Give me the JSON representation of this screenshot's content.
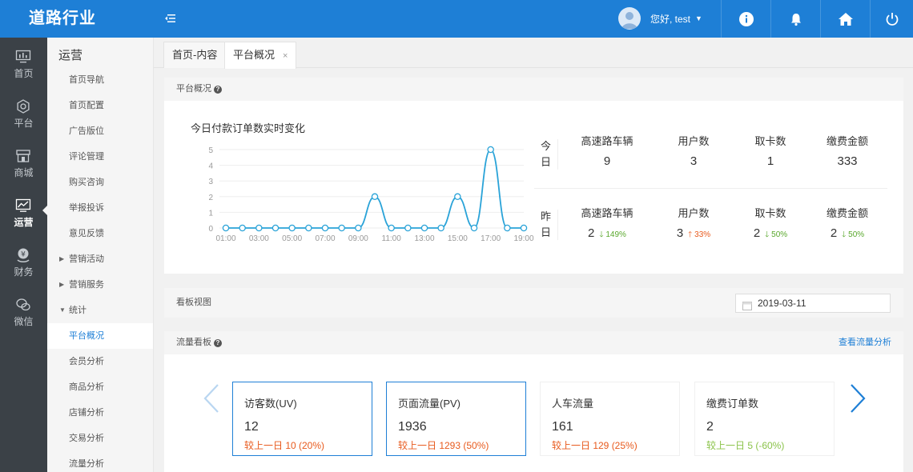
{
  "app": {
    "title": "道路行业"
  },
  "user": {
    "greeting": "您好, test"
  },
  "sidebar": {
    "items": [
      {
        "label": "首页",
        "icon": "monitor-icon"
      },
      {
        "label": "平台",
        "icon": "gear-icon"
      },
      {
        "label": "商城",
        "icon": "store-icon"
      },
      {
        "label": "运营",
        "icon": "chart-icon"
      },
      {
        "label": "财务",
        "icon": "finance-icon"
      },
      {
        "label": "微信",
        "icon": "wechat-icon"
      }
    ],
    "active": "运营"
  },
  "submenu": {
    "title": "运营",
    "items": [
      "首页导航",
      "首页配置",
      "广告版位",
      "评论管理",
      "购买咨询",
      "举报投诉",
      "意见反馈",
      "营销活动",
      "营销服务",
      "统计",
      "平台概况",
      "会员分析",
      "商品分析",
      "店铺分析",
      "交易分析",
      "流量分析"
    ]
  },
  "tabs": [
    {
      "label": "首页-内容"
    },
    {
      "label": "平台概况",
      "close": "×"
    }
  ],
  "overview": {
    "heading": "平台概况",
    "help": "?",
    "chart_title": "今日付款订单数实时变化",
    "today_label": [
      "今",
      "日"
    ],
    "yesterday_label": [
      "昨",
      "日"
    ],
    "today": [
      {
        "name": "高速路车辆",
        "value": "9"
      },
      {
        "name": "用户数",
        "value": "3"
      },
      {
        "name": "取卡数",
        "value": "1"
      },
      {
        "name": "缴费金额",
        "value": "333"
      }
    ],
    "yesterday": [
      {
        "name": "高速路车辆",
        "value": "2",
        "change": "149%",
        "dir": "down"
      },
      {
        "name": "用户数",
        "value": "3",
        "change": "33%",
        "dir": "up"
      },
      {
        "name": "取卡数",
        "value": "2",
        "change": "50%",
        "dir": "down"
      },
      {
        "name": "缴费金额",
        "value": "2",
        "change": "50%",
        "dir": "down"
      }
    ]
  },
  "board": {
    "heading": "看板视图",
    "date": "2019-03-11"
  },
  "traffic": {
    "heading": "流量看板",
    "help": "?",
    "link": "查看流量分析",
    "cards": [
      {
        "title": "访客数(UV)",
        "value": "12",
        "compare": "较上一日 10 (20%)",
        "dir": "up",
        "selected": true
      },
      {
        "title": "页面流量(PV)",
        "value": "1936",
        "compare": "较上一日 1293 (50%)",
        "dir": "up",
        "selected": true
      },
      {
        "title": "人车流量",
        "value": "161",
        "compare": "较上一日 129 (25%)",
        "dir": "up",
        "selected": false
      },
      {
        "title": "缴费订单数",
        "value": "2",
        "compare": "较上一日 5 (-60%)",
        "dir": "down",
        "selected": false
      }
    ]
  },
  "chart_data": {
    "type": "line",
    "title": "今日付款订单数实时变化",
    "x": [
      "01:00",
      "02:00",
      "03:00",
      "04:00",
      "05:00",
      "06:00",
      "07:00",
      "08:00",
      "09:00",
      "10:00",
      "11:00",
      "12:00",
      "13:00",
      "14:00",
      "15:00",
      "16:00",
      "17:00",
      "18:00",
      "19:00"
    ],
    "x_tick_labels": [
      "01:00",
      "03:00",
      "05:00",
      "07:00",
      "09:00",
      "11:00",
      "13:00",
      "15:00",
      "17:00",
      "19:00"
    ],
    "series": [
      {
        "values": [
          0,
          0,
          0,
          0,
          0,
          0,
          0,
          0,
          0,
          2,
          0,
          0,
          0,
          0,
          2,
          0,
          5,
          0,
          0
        ]
      }
    ],
    "ylim": [
      0,
      5
    ],
    "yticks": [
      "0",
      "1",
      "2",
      "3",
      "4",
      "5"
    ],
    "color": "#2aa3d8",
    "grid": "horizontal"
  }
}
